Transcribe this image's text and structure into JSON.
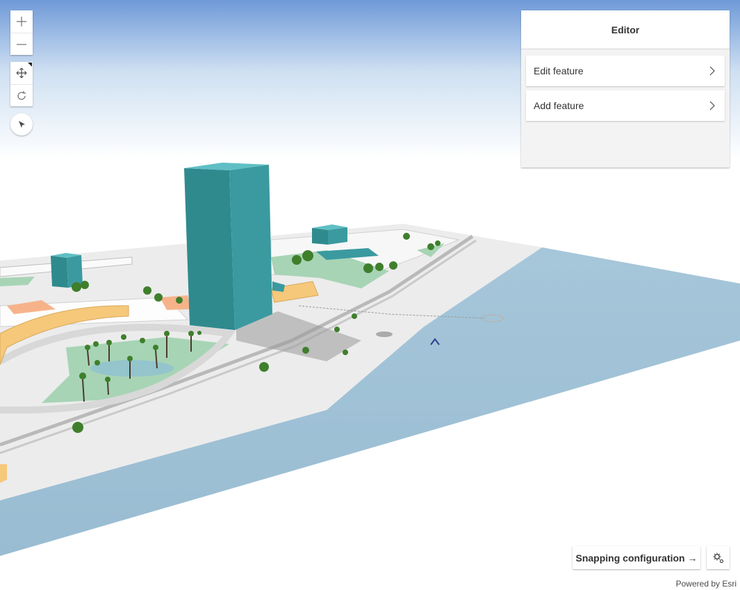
{
  "navigation": {
    "zoom_in_icon": "plus-icon",
    "zoom_out_icon": "minus-icon",
    "pan_icon": "move-icon",
    "rotate_icon": "rotate-icon",
    "compass_icon": "compass-icon"
  },
  "editor": {
    "title": "Editor",
    "items": [
      {
        "label": "Edit feature",
        "icon": "chevron-right-icon"
      },
      {
        "label": "Add feature",
        "icon": "chevron-right-icon"
      }
    ]
  },
  "snapping": {
    "label": "Snapping configuration →",
    "settings_icon": "gear-icon"
  },
  "attribution": "Powered by Esri",
  "colors": {
    "sky_top": "#6f9ad8",
    "water": "#9ec0d4",
    "building": "#2f8a8e",
    "park": "#a7d4b5",
    "ground": "#ececec",
    "accent_orange": "#f5c87a"
  }
}
